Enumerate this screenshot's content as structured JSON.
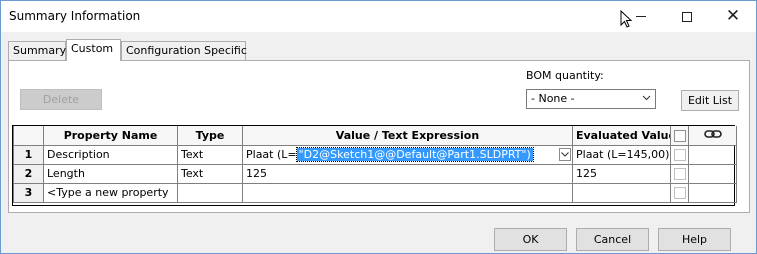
{
  "window": {
    "title": "Summary Information"
  },
  "tabs": [
    {
      "label": "Summary"
    },
    {
      "label": "Custom"
    },
    {
      "label": "Configuration Specific"
    }
  ],
  "toolbar": {
    "delete_label": "Delete",
    "bom_label": "BOM quantity:",
    "bom_value": "- None -",
    "edit_list_label": "Edit List"
  },
  "grid": {
    "headers": [
      "Property Name",
      "Type",
      "Value / Text Expression",
      "Evaluated Value"
    ],
    "rows": [
      {
        "num": "1",
        "name": "Description",
        "type": "Text",
        "value_prefix": "Plaat (L=",
        "value_selected": "\"D2@Sketch1@@Default@Part1.SLDPRT\")",
        "evaluated": "Plaat (L=145,00)"
      },
      {
        "num": "2",
        "name": "Length",
        "type": "Text",
        "value": "125",
        "evaluated": "125"
      },
      {
        "num": "3",
        "name": "<Type a new property"
      }
    ]
  },
  "footer": {
    "ok_label": "OK",
    "cancel_label": "Cancel",
    "help_label": "Help"
  }
}
